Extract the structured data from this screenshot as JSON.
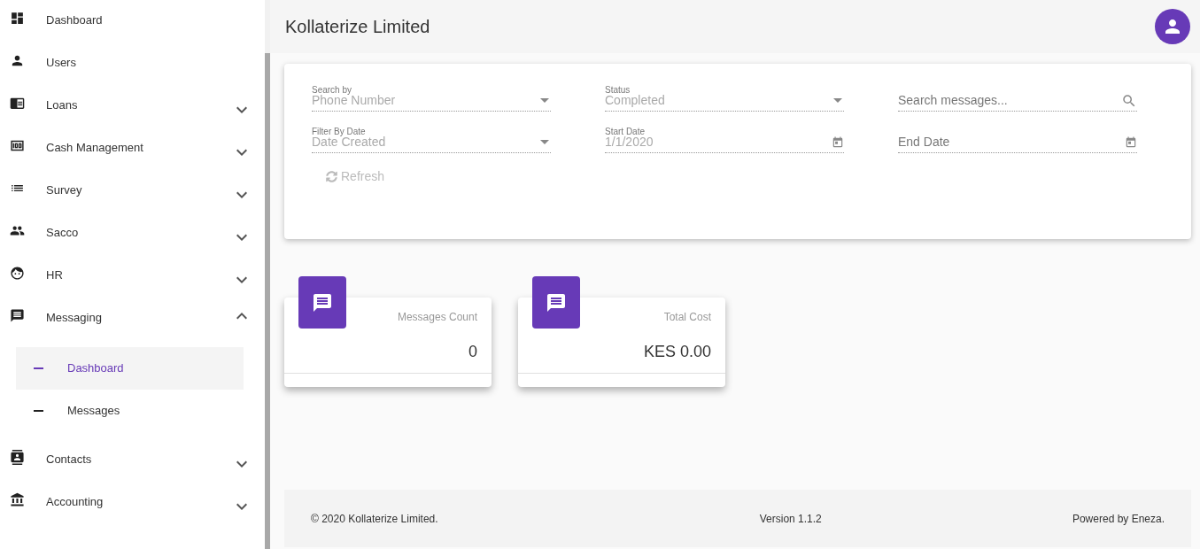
{
  "sidebar": {
    "items": [
      {
        "label": "Dashboard",
        "kind": "link"
      },
      {
        "label": "Users",
        "kind": "link"
      },
      {
        "label": "Loans",
        "kind": "group",
        "expanded": false
      },
      {
        "label": "Cash Management",
        "kind": "group",
        "expanded": false
      },
      {
        "label": "Survey",
        "kind": "group",
        "expanded": false
      },
      {
        "label": "Sacco",
        "kind": "group",
        "expanded": false
      },
      {
        "label": "HR",
        "kind": "group",
        "expanded": false
      },
      {
        "label": "Messaging",
        "kind": "group",
        "expanded": true,
        "children": [
          {
            "label": "Dashboard",
            "selected": true
          },
          {
            "label": "Messages",
            "selected": false
          }
        ]
      },
      {
        "label": "Contacts",
        "kind": "group",
        "expanded": false
      },
      {
        "label": "Accounting",
        "kind": "group",
        "expanded": false
      }
    ]
  },
  "header": {
    "title": "Kollaterize Limited"
  },
  "filters": {
    "fields": [
      {
        "kind": "select",
        "label": "Search by",
        "value": "Phone Number",
        "disabled": true
      },
      {
        "kind": "select",
        "label": "Status",
        "value": "Completed",
        "disabled": true
      },
      {
        "kind": "search",
        "placeholder": "Search messages...",
        "disabled": false
      },
      {
        "kind": "select",
        "label": "Filter By Date",
        "value": "Date Created",
        "disabled": true
      },
      {
        "kind": "date",
        "label": "Start Date",
        "value": "1/1/2020",
        "disabled": true
      },
      {
        "kind": "date",
        "placeholder": "End Date",
        "disabled": false
      }
    ],
    "refresh": {
      "label": "Refresh",
      "disabled": true
    }
  },
  "stats": [
    {
      "label": "Messages Count",
      "value": "0"
    },
    {
      "label": "Total Cost",
      "value": "KES 0.00"
    }
  ],
  "footer": {
    "copyright": "© 2020 Kollaterize Limited.",
    "version": "Version 1.1.2",
    "powered": "Powered by Eneza."
  }
}
